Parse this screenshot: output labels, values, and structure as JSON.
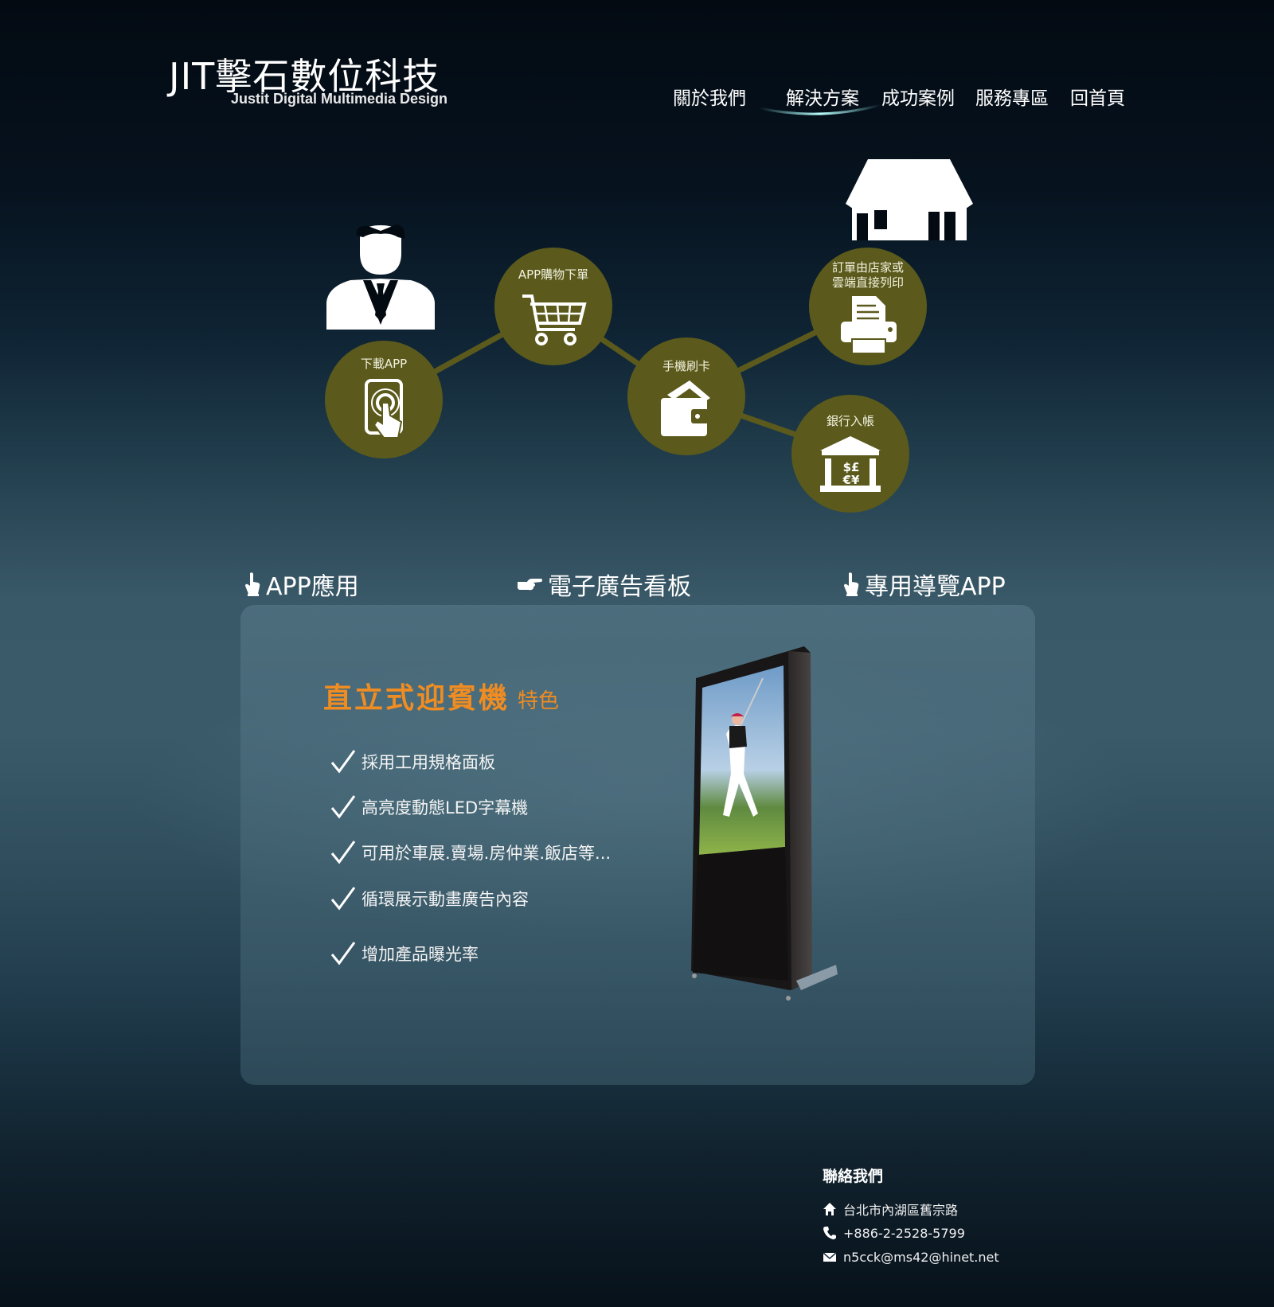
{
  "header": {
    "logo_main": "JIT擊石數位科技",
    "logo_sub": "Justit  Digital Multimedia Design"
  },
  "nav": {
    "items": [
      {
        "label": "關於我們"
      },
      {
        "label": "解決方案",
        "active": true
      },
      {
        "label": "成功案例"
      },
      {
        "label": "服務專區"
      },
      {
        "label": "回首頁"
      }
    ]
  },
  "flow": {
    "nodes": [
      {
        "label": "下載APP",
        "icon": "phone-touch-icon"
      },
      {
        "label": "APP購物下單",
        "icon": "shopping-cart-icon"
      },
      {
        "label": "手機刷卡",
        "icon": "wallet-icon"
      },
      {
        "label": "訂單由店家或\n雲端直接列印",
        "icon": "printer-icon"
      },
      {
        "label": "銀行入帳",
        "icon": "bank-icon"
      }
    ],
    "person_icon": "businessman-icon",
    "store_icon": "store-house-icon",
    "bubble_color": "#5b5a1c"
  },
  "tabs": [
    {
      "label": "APP應用"
    },
    {
      "label": "電子廣告看板"
    },
    {
      "label": "專用導覽APP"
    }
  ],
  "feature": {
    "title": "直立式迎賓機",
    "title_suffix": "特色",
    "accent_color": "#ef8c22",
    "items": [
      "採用工用規格面板",
      "高亮度動態LED字幕機",
      "可用於車展.賣場.房仲業.飯店等...",
      "循環展示動畫廣告內容",
      "增加產品曝光率"
    ]
  },
  "contact": {
    "title": "聯絡我們",
    "address": "台北市內湖區舊宗路",
    "phone": "+886-2-2528-5799",
    "email": "n5cck@ms42@hinet.net"
  }
}
